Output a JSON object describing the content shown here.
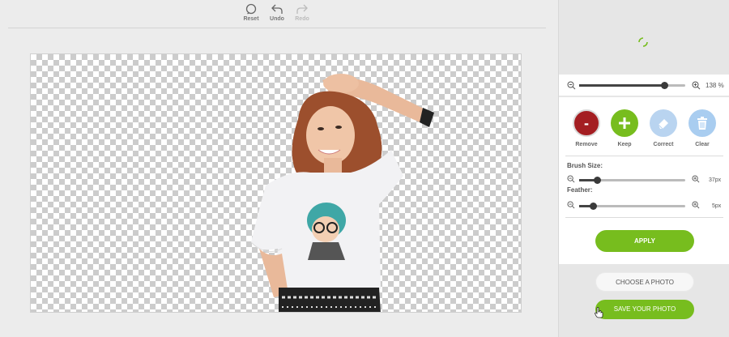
{
  "toolbar": {
    "reset_label": "Reset",
    "undo_label": "Undo",
    "redo_label": "Redo"
  },
  "zoom": {
    "level_fraction": 0.8,
    "label": "138 %"
  },
  "tools": {
    "remove_label": "Remove",
    "remove_symbol": "-",
    "keep_label": "Keep",
    "correct_label": "Correct",
    "clear_label": "Clear"
  },
  "brush": {
    "label": "Brush Size:",
    "value": "37px",
    "level_fraction": 0.17
  },
  "feather": {
    "label": "Feather:",
    "value": "5px",
    "level_fraction": 0.13
  },
  "actions": {
    "apply_label": "APPLY",
    "choose_label": "CHOOSE A PHOTO",
    "save_label": "SAVE YOUR PHOTO"
  },
  "colors": {
    "accent_green": "#77bd1e",
    "remove_red": "#a41e22",
    "correct_blue": "#b9d4f0",
    "clear_blue": "#a9cdf0"
  }
}
